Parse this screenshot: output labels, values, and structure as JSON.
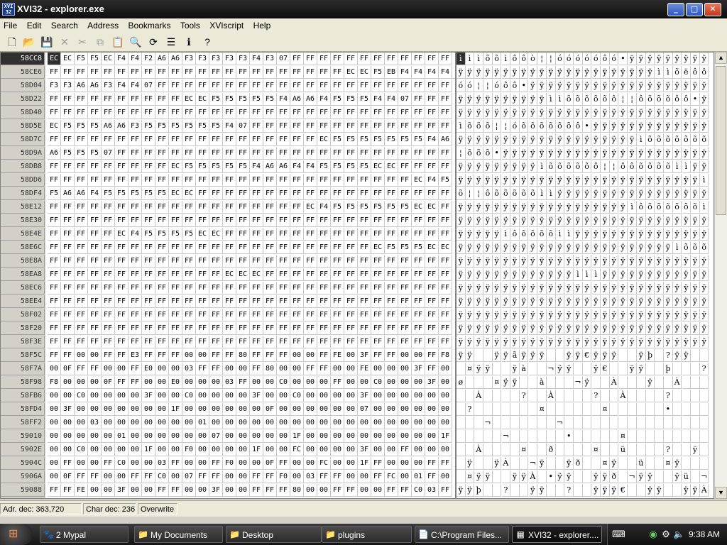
{
  "window": {
    "title": "XVI32 - explorer.exe",
    "app_icon_text": "XVI\n32",
    "buttons": {
      "minimize": "_",
      "maximize": "□",
      "close": "✕"
    }
  },
  "menu": [
    "File",
    "Edit",
    "Search",
    "Address",
    "Bookmarks",
    "Tools",
    "XVIscript",
    "Help"
  ],
  "toolbar": [
    {
      "name": "new-file-icon",
      "glyph": "🗋",
      "enabled": true
    },
    {
      "name": "open-file-icon",
      "glyph": "📂",
      "enabled": true
    },
    {
      "name": "save-icon",
      "glyph": "💾",
      "enabled": true
    },
    {
      "name": "delete-icon",
      "glyph": "✕",
      "enabled": false
    },
    {
      "name": "cut-icon",
      "glyph": "✂",
      "enabled": false
    },
    {
      "name": "copy-icon",
      "glyph": "⧉",
      "enabled": false
    },
    {
      "name": "paste-icon",
      "glyph": "📋",
      "enabled": true
    },
    {
      "name": "find-icon",
      "glyph": "🔍",
      "enabled": true
    },
    {
      "name": "find-replace-icon",
      "glyph": "⟳",
      "enabled": true
    },
    {
      "name": "properties-icon",
      "glyph": "☰",
      "enabled": true
    },
    {
      "name": "info-icon",
      "glyph": "ℹ",
      "enabled": true
    },
    {
      "name": "help-icon",
      "glyph": "?",
      "enabled": true
    }
  ],
  "hex": {
    "selected": {
      "row": 0,
      "col": 0
    },
    "rows": [
      {
        "addr": "58CC8",
        "bytes": "EC EC F5 F5 EC F4 F4 F2 A6 A6 F3 F3 F3 F3 F3 F4 F3 07 FF FF FF FF FF FF FF FF FF FF FF FF",
        "chars": "ìììõõìôôò¦¦óóóóóôó•ÿÿÿÿÿÿÿÿÿÿÿÿ"
      },
      {
        "addr": "58CE6",
        "bytes": "FF FF FF FF FF FF FF FF FF FF FF FF FF FF FF FF FF FF FF FF FF FF EC EC F5 EB F4 F4 F4 F4 F4 F3",
        "chars": "ÿÿÿÿÿÿÿÿÿÿÿÿÿÿÿÿÿÿÿÿÿÿììõëôôôôôó"
      },
      {
        "addr": "58D04",
        "bytes": "F3 F3 A6 A6 F3 F4 F4 07 FF FF FF FF FF FF FF FF FF FF FF FF FF FF FF FF FF FF FF FF FF FF",
        "chars": "óó¦¦óôô•ÿÿÿÿÿÿÿÿÿÿÿÿÿÿÿÿÿÿÿÿÿÿ"
      },
      {
        "addr": "58D22",
        "bytes": "FF FF FF FF FF FF FF FF FF FF EC EC F5 F5 F5 F5 F5 F4 A6 A6 F4 F5 F5 F5 F4 F4 07 FF FF FF",
        "chars": "ÿÿÿÿÿÿÿÿÿÿììõõõõõô¦¦ôõõõôô•ÿÿÿ"
      },
      {
        "addr": "58D40",
        "bytes": "FF FF FF FF FF FF FF FF FF FF FF FF FF FF FF FF FF FF FF FF FF FF FF FF FF FF FF FF FF FF",
        "chars": "ÿÿÿÿÿÿÿÿÿÿÿÿÿÿÿÿÿÿÿÿÿÿÿÿÿÿÿÿÿÿ"
      },
      {
        "addr": "58D5E",
        "bytes": "EC F5 F5 F5 A6 A6 F3 F5 F5 F5 F5 F5 F5 F4 07 FF FF FF FF FF FF FF FF FF FF FF FF FF FF FF",
        "chars": "ìõõõ¦¦óõõõõõõô•ÿÿÿÿÿÿÿÿÿÿÿÿÿÿÿ"
      },
      {
        "addr": "58D7C",
        "bytes": "FF FF FF FF FF FF FF FF FF FF FF FF FF FF FF FF FF FF FF FF EC F5 F5 F5 F5 F5 F5 F5 F4 A6",
        "chars": "ÿÿÿÿÿÿÿÿÿÿÿÿÿÿÿÿÿÿÿÿìõõõõõõõô¦"
      },
      {
        "addr": "58D9A",
        "bytes": "A6 F5 F5 F5 07 FF FF FF FF FF FF FF FF FF FF FF FF FF FF FF FF FF FF FF FF FF FF FF FF FF",
        "chars": "¦õõõ•ÿÿÿÿÿÿÿÿÿÿÿÿÿÿÿÿÿÿÿÿÿÿÿÿÿ"
      },
      {
        "addr": "58DB8",
        "bytes": "FF FF FF FF FF FF FF FF FF EC F5 F5 F5 F5 F5 F4 A6 A6 F4 F4 F5 F5 F5 F5 EC EC FF FF FF FF",
        "chars": "ÿÿÿÿÿÿÿÿÿìõõõõõô¦¦ôôõõõõììÿÿÿÿ"
      },
      {
        "addr": "58DD6",
        "bytes": "FF FF FF FF FF FF FF FF FF FF FF FF FF FF FF FF FF FF FF FF FF FF FF FF FF FF FF EC F4 F5",
        "chars": "ÿÿÿÿÿÿÿÿÿÿÿÿÿÿÿÿÿÿÿÿÿÿÿÿÿÿÿìôõ"
      },
      {
        "addr": "58DF4",
        "bytes": "F5 A6 A6 F4 F5 F5 F5 F5 F5 EC EC FF FF FF FF FF FF FF FF FF FF FF FF FF FF FF FF FF FF FF",
        "chars": "õ¦¦ôõõõõõììÿÿÿÿÿÿÿÿÿÿÿÿÿÿÿÿÿÿÿ"
      },
      {
        "addr": "58E12",
        "bytes": "FF FF FF FF FF FF FF FF FF FF FF FF FF FF FF FF FF FF FF EC F4 F5 F5 F5 F5 F5 F5 EC EC FF",
        "chars": "ÿÿÿÿÿÿÿÿÿÿÿÿÿÿÿÿÿÿÿìôõõõõõõììÿ"
      },
      {
        "addr": "58E30",
        "bytes": "FF FF FF FF FF FF FF FF FF FF FF FF FF FF FF FF FF FF FF FF FF FF FF FF FF FF FF FF FF FF",
        "chars": "ÿÿÿÿÿÿÿÿÿÿÿÿÿÿÿÿÿÿÿÿÿÿÿÿÿÿÿÿÿÿ"
      },
      {
        "addr": "58E4E",
        "bytes": "FF FF FF FF FF EC F4 F5 F5 F5 F5 EC EC FF FF FF FF FF FF FF FF FF FF FF FF FF FF FF FF FF",
        "chars": "ÿÿÿÿÿìôõõõõììÿÿÿÿÿÿÿÿÿÿÿÿÿÿÿÿÿ"
      },
      {
        "addr": "58E6C",
        "bytes": "FF FF FF FF FF FF FF FF FF FF FF FF FF FF FF FF FF FF FF FF FF FF FF FF EC F5 F5 F5 EC EC",
        "chars": "ÿÿÿÿÿÿÿÿÿÿÿÿÿÿÿÿÿÿÿÿÿÿÿÿìõõõìì"
      },
      {
        "addr": "58E8A",
        "bytes": "FF FF FF FF FF FF FF FF FF FF FF FF FF FF FF FF FF FF FF FF FF FF FF FF FF FF FF FF FF FF",
        "chars": "ÿÿÿÿÿÿÿÿÿÿÿÿÿÿÿÿÿÿÿÿÿÿÿÿÿÿÿÿÿÿ"
      },
      {
        "addr": "58EA8",
        "bytes": "FF FF FF FF FF FF FF FF FF FF FF FF FF EC EC EC FF FF FF FF FF FF FF FF FF FF FF FF FF FF",
        "chars": "ÿÿÿÿÿÿÿÿÿÿÿÿÿìììÿÿÿÿÿÿÿÿÿÿÿÿÿÿ"
      },
      {
        "addr": "58EC6",
        "bytes": "FF FF FF FF FF FF FF FF FF FF FF FF FF FF FF FF FF FF FF FF FF FF FF FF FF FF FF FF FF FF",
        "chars": "ÿÿÿÿÿÿÿÿÿÿÿÿÿÿÿÿÿÿÿÿÿÿÿÿÿÿÿÿÿÿ"
      },
      {
        "addr": "58EE4",
        "bytes": "FF FF FF FF FF FF FF FF FF FF FF FF FF FF FF FF FF FF FF FF FF FF FF FF FF FF FF FF FF FF",
        "chars": "ÿÿÿÿÿÿÿÿÿÿÿÿÿÿÿÿÿÿÿÿÿÿÿÿÿÿÿÿÿÿ"
      },
      {
        "addr": "58F02",
        "bytes": "FF FF FF FF FF FF FF FF FF FF FF FF FF FF FF FF FF FF FF FF FF FF FF FF FF FF FF FF FF FF",
        "chars": "ÿÿÿÿÿÿÿÿÿÿÿÿÿÿÿÿÿÿÿÿÿÿÿÿÿÿÿÿÿÿ"
      },
      {
        "addr": "58F20",
        "bytes": "FF FF FF FF FF FF FF FF FF FF FF FF FF FF FF FF FF FF FF FF FF FF FF FF FF FF FF FF FF FF",
        "chars": "ÿÿÿÿÿÿÿÿÿÿÿÿÿÿÿÿÿÿÿÿÿÿÿÿÿÿÿÿÿÿ"
      },
      {
        "addr": "58F3E",
        "bytes": "FF FF FF FF FF FF FF FF FF FF FF FF FF FF FF FF FF FF FF FF FF FF FF FF FF FF FF FF FF FF",
        "chars": "ÿÿÿÿÿÿÿÿÿÿÿÿÿÿÿÿÿÿÿÿÿÿÿÿÿÿÿÿÿÿ"
      },
      {
        "addr": "58F5C",
        "bytes": "FF FF 00 00 FF FF E3 FF FF FF 00 00 FF FF 80 FF FF FF 00 00 FF FE 00 3F FF FF 00 00 FF F8",
        "chars": "ÿÿ  ÿÿãÿÿÿ  ÿÿ€ÿÿÿ  ÿþ ?ÿÿ  ÿø"
      },
      {
        "addr": "58F7A",
        "bytes": "00 0F FF FF 00 00 FF E0 00 00 03 FF FF 00 00 FF 80 00 00 FF FF 00 00 FE 00 00 00 3F FF 00",
        "chars": " ¤ÿÿ  ÿà  ¬ÿÿ  ÿ€  ÿÿ  þ   ?ÿ "
      },
      {
        "addr": "58F98",
        "bytes": "F8 00 00 00 0F FF FF 00 00 E0 00 00 00 03 FF 00 00 C0 00 00 00 FF 00 00 C0 00 00 00 3F 00",
        "chars": "ø   ¤ÿÿ  à   ¬ÿ  À   ÿ  À   ? "
      },
      {
        "addr": "58FB6",
        "bytes": "00 00 C0 00 00 00 00 3F 00 00 C0 00 00 00 00 3F 00 00 C0 00 00 00 00 3F 00 00 00 00 00 00",
        "chars": "  À    ?  À    ?  À    ?      "
      },
      {
        "addr": "58FD4",
        "bytes": "00 3F 00 00 00 00 00 00 00 1F 00 00 00 00 00 00 0F 00 00 00 00 00 00 07 00 00 00 00 00 00",
        "chars": " ?       ¤      ¤      •      "
      },
      {
        "addr": "58FF2",
        "bytes": "00 00 00 03 00 00 00 00 00 00 00 01 00 00 00 00 00 00 00 00 00 00 00 00 00 00 00 00 00 00",
        "chars": "   ¬       ¬                  "
      },
      {
        "addr": "59010",
        "bytes": "00 00 00 00 00 01 00 00 00 00 00 00 07 00 00 00 00 00 1F 00 00 00 00 00 00 00 00 00 00 1F",
        "chars": "     ¬      •     ¤          ¤"
      },
      {
        "addr": "5902E",
        "bytes": "00 00 C0 00 00 00 00 1F 00 00 F0 00 00 00 00 1F 00 00 FC 00 00 00 00 3F 00 00 FF 00 00 00",
        "chars": "  À    ¤  ð    ¤  ü    ?  ÿ   "
      },
      {
        "addr": "5904C",
        "bytes": "00 FF 00 00 FF C0 00 00 03 FF 00 00 FF F0 00 00 0F FF 00 00 FC 00 00 1F FF 00 00 00 FF FF",
        "chars": " ÿ  ÿÀ  ¬ÿ  ÿð  ¤ÿ  ü  ¤ÿ   ÿÿ"
      },
      {
        "addr": "5906A",
        "bytes": "00 0F FF FF 00 00 FF FF C0 00 07 FF FF 00 00 FF FF F0 00 03 FF FF 00 00 FF FC 00 01 FF 00",
        "chars": " ¤ÿÿ  ÿÿÀ •ÿÿ  ÿÿð ¬ÿÿ  ÿü ¬ÿ "
      },
      {
        "addr": "59088",
        "bytes": "FF FF FE 00 00 3F 00 00 FF FF 00 00 3F 00 00 FF FF FF 80 00 00 FF FF 00 00 FF FF C0 03 FF",
        "chars": "ÿÿþ  ?  ÿÿ  ?  ÿÿÿ€  ÿÿ  ÿÿÀ¬ÿ"
      }
    ]
  },
  "status": {
    "adr": "Adr. dec: 363,720",
    "chr": "Char dec: 236",
    "mode": "Overwrite"
  },
  "taskbar": {
    "start_icon": "start-orb-icon",
    "tasks": [
      {
        "label": "2 Mypal",
        "icon": "🐾",
        "active": false
      },
      {
        "label": "My Documents",
        "icon": "📁",
        "active": false
      },
      {
        "label": "Desktop",
        "icon": "📁",
        "active": false
      },
      {
        "label": "plugins",
        "icon": "📁",
        "active": false
      },
      {
        "label": "C:\\Program Files...",
        "icon": "📄",
        "active": false
      },
      {
        "label": "XVI32 - explorer....",
        "icon": "▦",
        "active": true
      }
    ],
    "clock": "9:38 AM"
  }
}
